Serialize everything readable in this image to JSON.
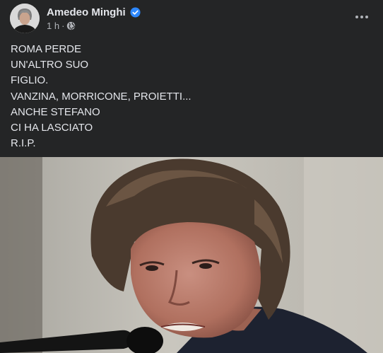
{
  "post": {
    "author": "Amedeo Minghi",
    "time": "1 h",
    "separator": "·",
    "lines": [
      "ROMA PERDE",
      "UN'ALTRO SUO",
      "FIGLIO.",
      "VANZINA, MORRICONE, PROIETTI...",
      "ANCHE STEFANO",
      "CI HA LASCIATO",
      "R.I.P."
    ]
  },
  "icons": {
    "verified": "verified-badge-icon",
    "audience": "globe-icon",
    "more": "more-options-icon"
  },
  "colors": {
    "background": "#242526",
    "text_primary": "#e4e6eb",
    "text_secondary": "#b0b3b8",
    "verified_blue": "#2d88ff"
  }
}
